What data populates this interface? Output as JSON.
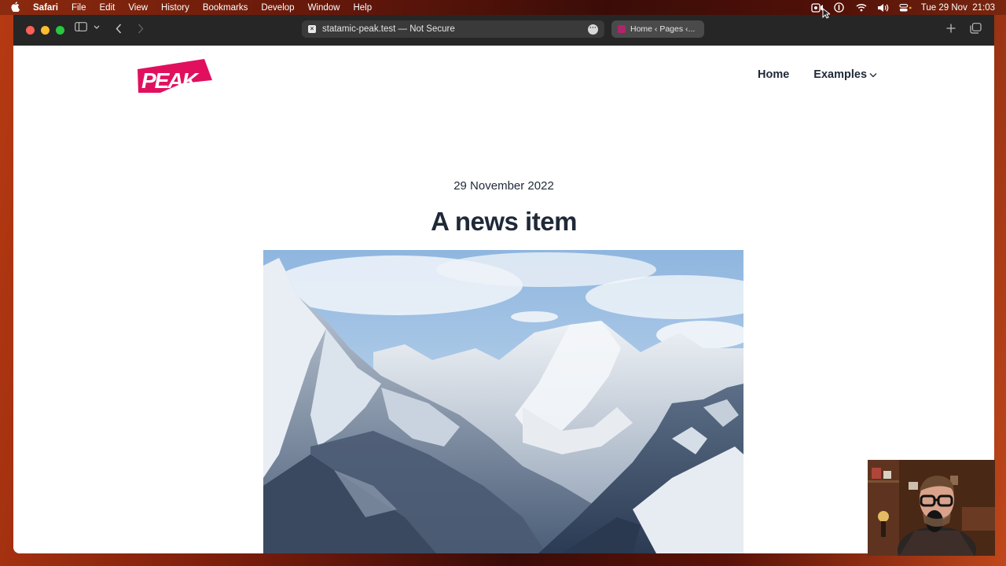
{
  "menubar": {
    "app_name": "Safari",
    "menus": [
      "File",
      "Edit",
      "View",
      "History",
      "Bookmarks",
      "Develop",
      "Window",
      "Help"
    ],
    "datetime": "Tue 29 Nov  21:03",
    "status_icons": [
      "screen-record-icon",
      "onepassword-icon",
      "wifi-icon",
      "volume-icon",
      "control-center-icon"
    ]
  },
  "browser": {
    "address": "statamic-peak.test — Not Secure",
    "tab_title": "Home ‹ Pages ‹..."
  },
  "site": {
    "logo_text": "PEAK",
    "brand_color": "#e0105f",
    "nav": {
      "home": "Home",
      "examples": "Examples"
    }
  },
  "article": {
    "date": "29 November 2022",
    "title": "A news item"
  }
}
